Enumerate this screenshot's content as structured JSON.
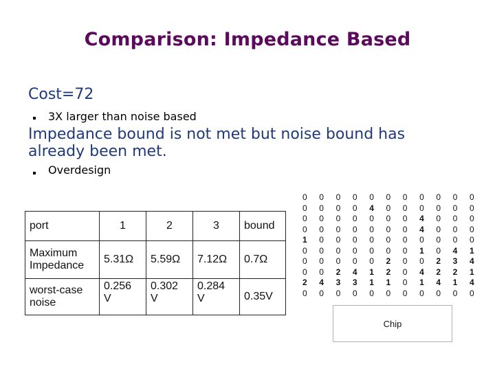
{
  "slide": {
    "title": "Comparison: Impedance Based",
    "bullets": [
      {
        "level": 1,
        "text": "Cost=72"
      },
      {
        "level": 2,
        "text": "3X larger than noise based"
      },
      {
        "level": 1,
        "text": "Impedance bound is not met but noise bound has"
      },
      {
        "level": 1,
        "text": "already been met."
      },
      {
        "level": 2,
        "text": "Overdesign"
      }
    ],
    "colors": {
      "title": "#5c0a5c",
      "level1_text": "#1f3a7a",
      "level2_text": "#000000"
    }
  },
  "table": {
    "header": [
      "port",
      "1",
      "2",
      "3",
      "bound"
    ],
    "rows": [
      {
        "label": [
          "Maximum",
          "Impedance"
        ],
        "values": [
          "5.31Ω",
          "5.59Ω",
          "7.12Ω",
          "0.7Ω"
        ]
      },
      {
        "label": [
          "worst-case",
          "noise"
        ],
        "values": [
          [
            "0.256",
            "V"
          ],
          [
            "0.302",
            "V"
          ],
          [
            "0.284",
            "V"
          ],
          "0.35V"
        ]
      }
    ]
  },
  "grid": {
    "rows": [
      [
        0,
        0,
        0,
        0,
        0,
        0,
        0,
        0,
        0,
        0,
        0
      ],
      [
        0,
        0,
        0,
        0,
        4,
        0,
        0,
        0,
        0,
        0,
        0
      ],
      [
        0,
        0,
        0,
        0,
        0,
        0,
        0,
        4,
        0,
        0,
        0
      ],
      [
        0,
        0,
        0,
        0,
        0,
        0,
        0,
        4,
        0,
        0,
        0
      ],
      [
        1,
        0,
        0,
        0,
        0,
        0,
        0,
        0,
        0,
        0,
        0
      ],
      [
        0,
        0,
        0,
        0,
        0,
        0,
        0,
        1,
        0,
        4,
        1
      ],
      [
        0,
        0,
        0,
        0,
        0,
        2,
        0,
        0,
        2,
        3,
        4
      ],
      [
        0,
        0,
        2,
        4,
        1,
        2,
        0,
        4,
        2,
        2,
        1
      ],
      [
        2,
        4,
        3,
        3,
        1,
        1,
        0,
        1,
        4,
        1,
        4
      ],
      [
        0,
        0,
        0,
        0,
        0,
        0,
        0,
        0,
        0,
        0,
        0
      ]
    ]
  },
  "chip": {
    "label": "Chip"
  }
}
